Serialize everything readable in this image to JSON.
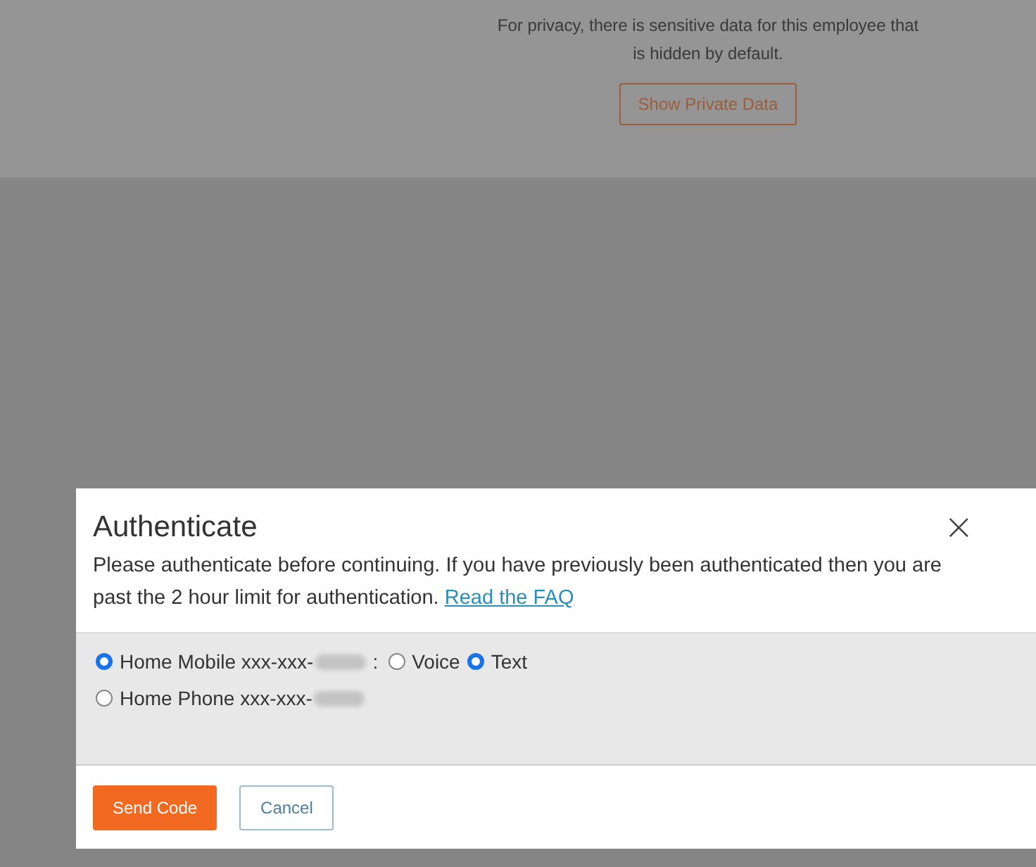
{
  "privacy_notice": {
    "message": "For privacy, there is sensitive data for this employee that is hidden by default.",
    "button": "Show Private Data"
  },
  "dialog": {
    "title": "Authenticate",
    "close": "×",
    "message": "Please authenticate before continuing. If you have previously been authenticated then you are past the 2 hour limit for authentication.",
    "link": "Read the FAQ",
    "options": [
      {
        "label": "Home Mobile xxx-xxx-",
        "redacted": true,
        "selected": true,
        "separator": ":",
        "methods": [
          {
            "label": "Voice",
            "selected": false
          },
          {
            "label": "Text",
            "selected": true
          }
        ]
      },
      {
        "label": "Home Phone xxx-xxx-",
        "redacted": true,
        "selected": false
      }
    ],
    "buttons": [
      {
        "label": "Send Code",
        "kind": "primary"
      },
      {
        "label": "Cancel",
        "kind": "secondary"
      }
    ]
  }
}
